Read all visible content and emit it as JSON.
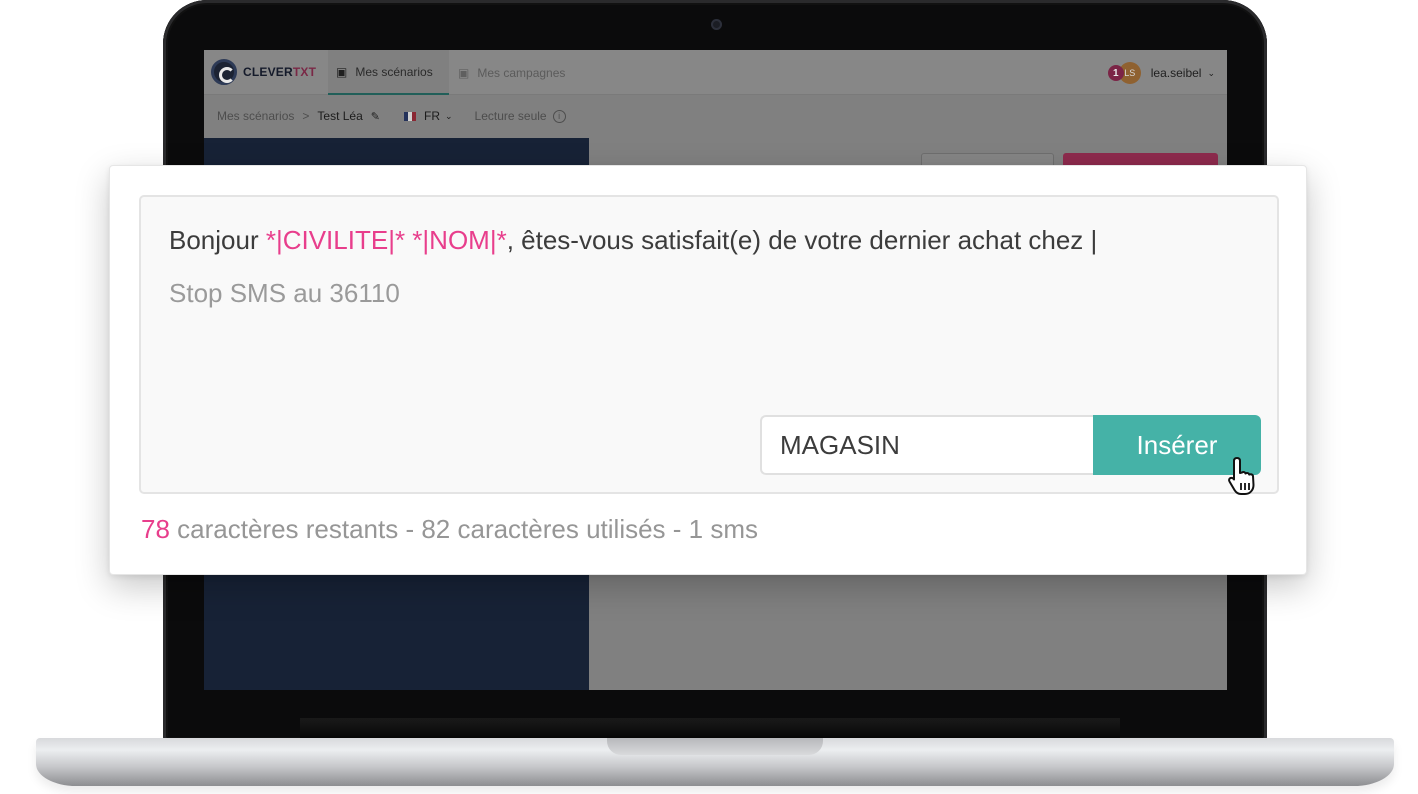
{
  "app": {
    "logo_prefix": "CLEVER",
    "logo_suffix": "TXT",
    "logo_mark_icon": "clevertxt-logo-icon"
  },
  "nav": {
    "tabs": [
      {
        "label": "Mes scénarios",
        "icon": "chat-bubbles-icon",
        "active": true
      },
      {
        "label": "Mes campagnes",
        "icon": "chat-bubbles-icon",
        "active": false
      }
    ]
  },
  "user": {
    "notification_count": "1",
    "initials": "LS",
    "name": "lea.seibel"
  },
  "breadcrumb": {
    "parent": "Mes scénarios",
    "separator": ">",
    "current": "Test Léa",
    "language": "FR",
    "mode": "Lecture seule"
  },
  "editor": {
    "greeting": "Bonjour ",
    "var_civilite": "*|CIVILITE|*",
    "space": " ",
    "var_nom": "*|NOM|*",
    "rest": ", êtes-vous satisfait(e) de votre dernier achat chez |",
    "stop_line": "Stop SMS au 36110"
  },
  "insert": {
    "field_value": "MAGASIN",
    "button_label": "Insérer"
  },
  "counter": {
    "remaining": "78",
    "summary": " caractères restants - 82 caractères utilisés - 1 sms"
  },
  "colors": {
    "accent_pink": "#e83e8c",
    "insert_button": "#45b2a7",
    "sidebar_dark": "#172236"
  }
}
